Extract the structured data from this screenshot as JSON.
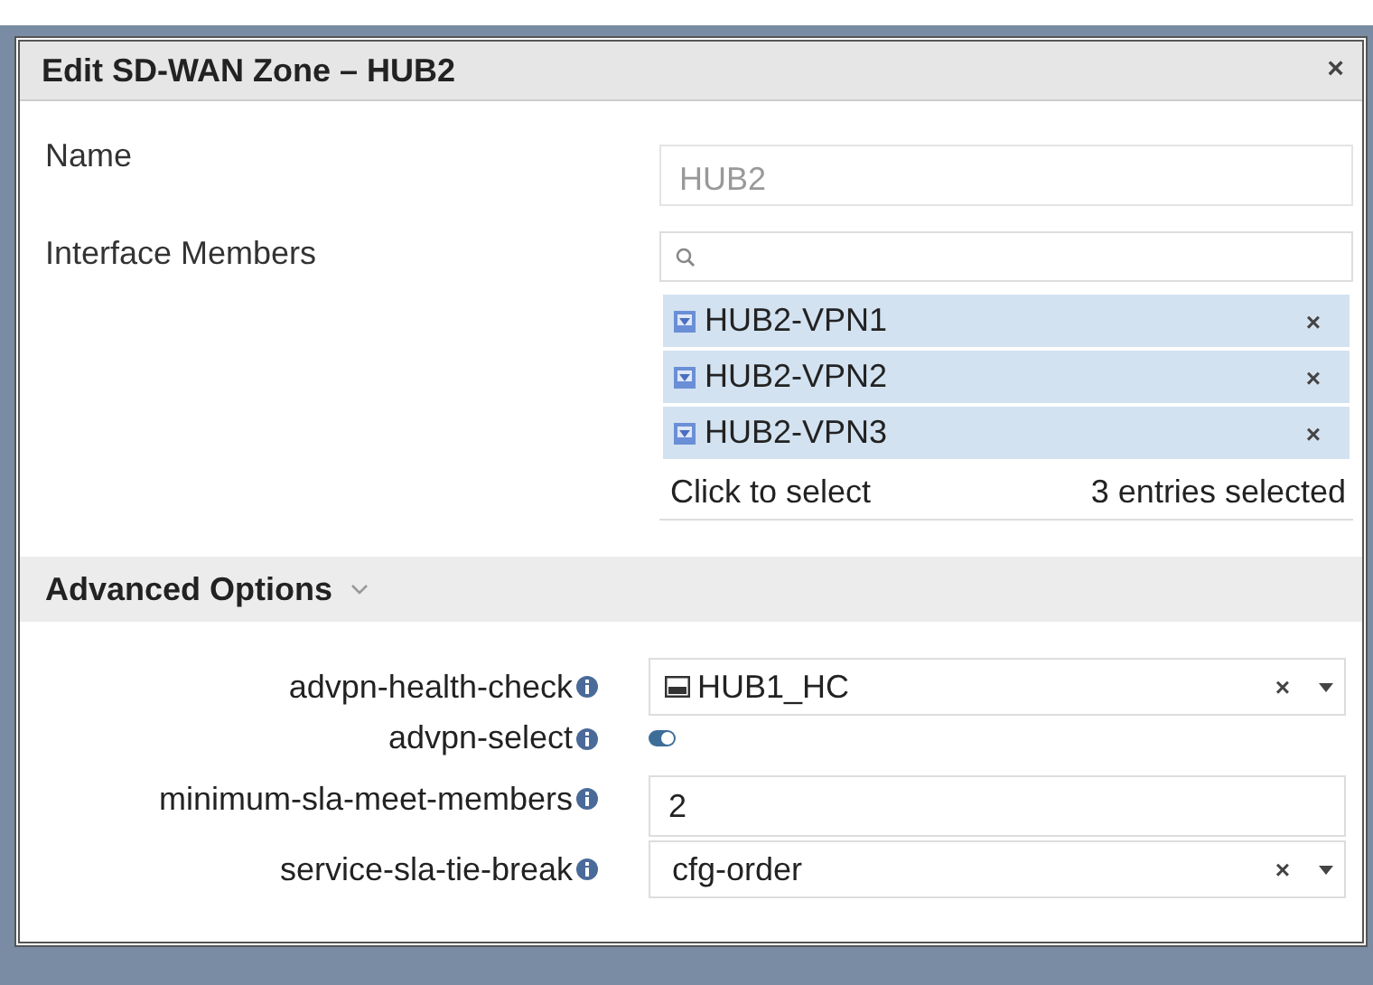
{
  "dialog": {
    "title": "Edit SD-WAN Zone – HUB2",
    "close": "×"
  },
  "name": {
    "label": "Name",
    "value": "HUB2"
  },
  "members": {
    "label": "Interface Members",
    "items": [
      {
        "name": "HUB2-VPN1",
        "remove": "×"
      },
      {
        "name": "HUB2-VPN2",
        "remove": "×"
      },
      {
        "name": "HUB2-VPN3",
        "remove": "×"
      }
    ],
    "hint": "Click to select",
    "count": "3 entries selected"
  },
  "advanced": {
    "title": "Advanced Options",
    "expanded": true,
    "fields": [
      {
        "kind": "select",
        "label": "advpn-health-check",
        "value": "HUB1_HC",
        "icon": true,
        "clear": "×"
      },
      {
        "kind": "toggle",
        "label": "advpn-select",
        "on": true
      },
      {
        "kind": "input",
        "label": "minimum-sla-meet-members",
        "value": "2"
      },
      {
        "kind": "select",
        "label": "service-sla-tie-break",
        "value": "cfg-order",
        "icon": false,
        "clear": "×"
      }
    ]
  }
}
